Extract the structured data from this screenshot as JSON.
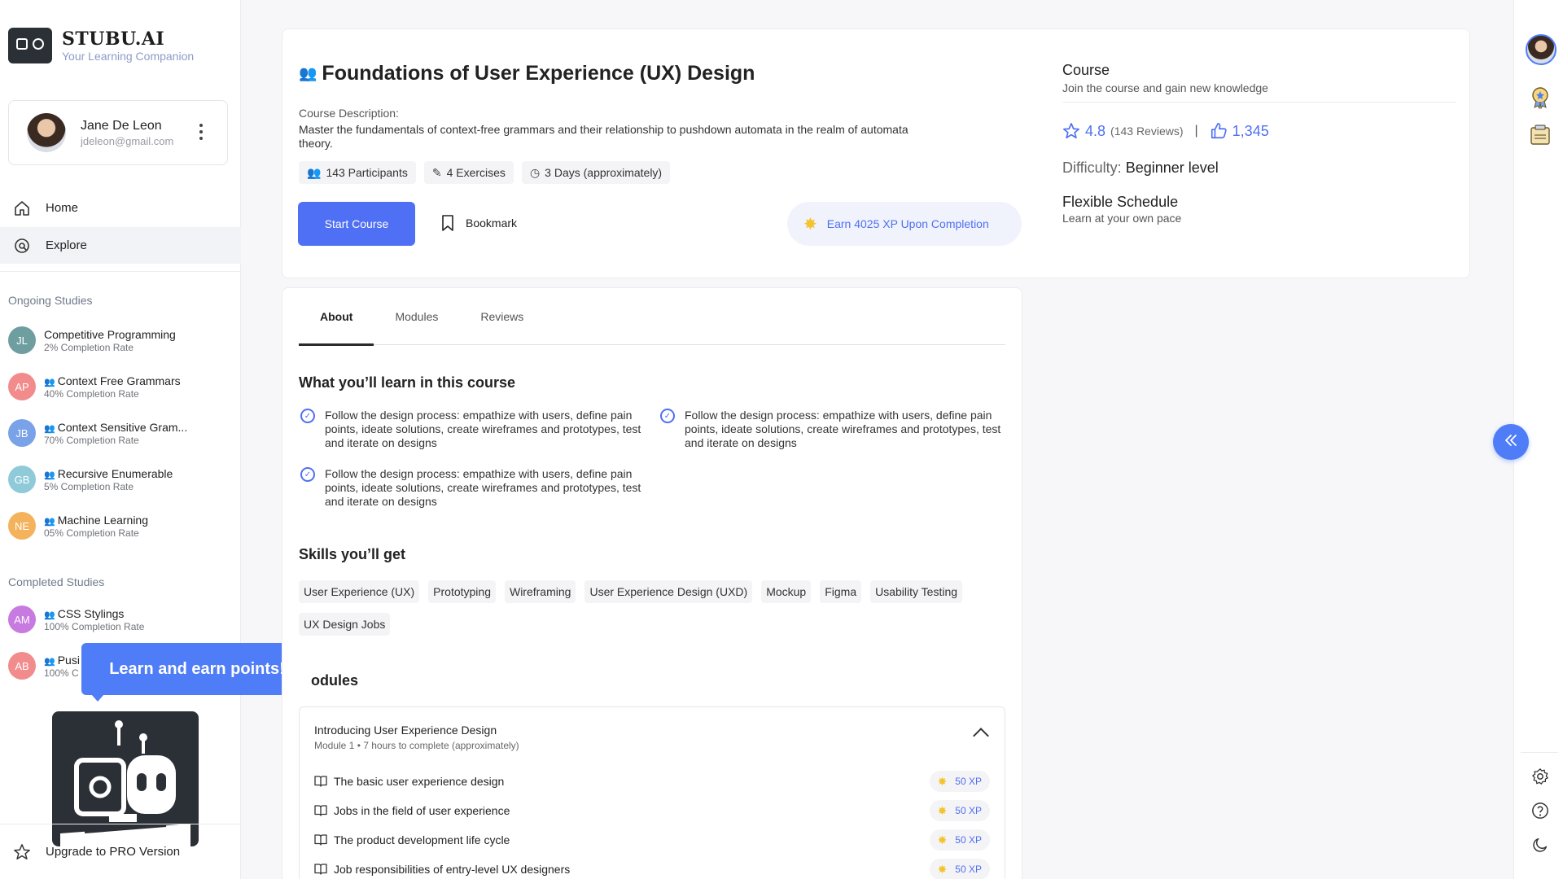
{
  "brand": {
    "name": "STUBU.AI",
    "tagline": "Your Learning Companion"
  },
  "user": {
    "name": "Jane De Leon",
    "email": "jdeleon@gmail.com"
  },
  "nav": [
    {
      "label": "Home",
      "icon": "home-icon"
    },
    {
      "label": "Explore",
      "icon": "explore-icon"
    }
  ],
  "ongoing": {
    "label": "Ongoing Studies",
    "items": [
      {
        "initials": "JL",
        "title": "Competitive Programming",
        "rate": "2% Completion Rate",
        "color": "#6f9ea0",
        "icon": false
      },
      {
        "initials": "AP",
        "title": "Context Free Grammars",
        "rate": "40% Completion Rate",
        "color": "#f28b8b",
        "icon": true
      },
      {
        "initials": "JB",
        "title": "Context Sensitive Gram...",
        "rate": "70% Completion Rate",
        "color": "#7aa2e8",
        "icon": true
      },
      {
        "initials": "GB",
        "title": "Recursive Enumerable",
        "rate": "5% Completion Rate",
        "color": "#8fcad9",
        "icon": true
      },
      {
        "initials": "NE",
        "title": "Machine Learning",
        "rate": "05% Completion Rate",
        "color": "#f5b25c",
        "icon": true
      }
    ]
  },
  "completed": {
    "label": "Completed Studies",
    "items": [
      {
        "initials": "AM",
        "title": "CSS Stylings",
        "rate": "100% Completion Rate",
        "color": "#c77ae0",
        "icon": true
      },
      {
        "initials": "AB",
        "title": "Pusi",
        "rate": "100% C",
        "color": "#f28b8b",
        "icon": true
      }
    ]
  },
  "tooltip": "Learn and earn points!",
  "upgrade": "Upgrade to PRO Version",
  "course": {
    "title": "Foundations of User Experience (UX) Design",
    "desc_label": "Course Description:",
    "desc": "Master the fundamentals of context-free grammars and their relationship to pushdown automata in the realm of automata theory.",
    "chips": [
      "143 Participants",
      "4 Exercises",
      "3 Days (approximately)"
    ],
    "start": "Start Course",
    "bookmark": "Bookmark",
    "earn": "Earn 4025 XP Upon Completion",
    "side_title": "Course",
    "side_sub": "Join the course and gain new knowledge",
    "rating": "4.8",
    "reviews": "(143 Reviews)",
    "likes": "1,345",
    "difficulty_label": "Difficulty:",
    "difficulty": "Beginner level",
    "schedule_title": "Flexible Schedule",
    "schedule_sub": "Learn at your own pace"
  },
  "tabs": [
    "About",
    "Modules",
    "Reviews"
  ],
  "learn_heading": "What you’ll learn in this course",
  "learn_items": [
    "Follow the design process: empathize with users, define pain points, ideate solutions, create wireframes and prototypes, test and iterate on designs",
    "Follow the design process: empathize with users, define pain points, ideate solutions, create wireframes and prototypes, test and iterate on designs",
    "Follow the design process: empathize with users, define pain points, ideate solutions, create wireframes and prototypes, test and iterate on designs"
  ],
  "skills_heading": "Skills you’ll get",
  "skills": [
    "User Experience (UX)",
    "Prototyping",
    "Wireframing",
    "User Experience Design (UXD)",
    "Mockup",
    "Figma",
    "Usability Testing",
    "UX Design Jobs"
  ],
  "modules_heading": "odules",
  "module": {
    "title": "Introducing User Experience Design",
    "sub": "Module 1 • 7 hours to complete (approximately)",
    "lessons": [
      {
        "title": "The basic user experience design",
        "xp": "50 XP"
      },
      {
        "title": "Jobs in the field of user experience",
        "xp": "50 XP"
      },
      {
        "title": "The product development life cycle",
        "xp": "50 XP"
      },
      {
        "title": "Job responsibilities of entry-level UX designers",
        "xp": "50 XP"
      }
    ]
  },
  "colors": {
    "accent": "#4f6ff4",
    "star": "#f4c430"
  }
}
